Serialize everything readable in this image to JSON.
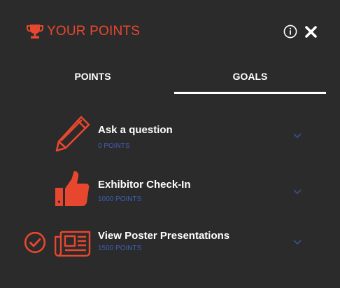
{
  "header": {
    "title": "YOUR POINTS",
    "icons": {
      "title_icon": "trophy-icon",
      "info": "info-icon",
      "close": "close-icon"
    }
  },
  "tabs": [
    {
      "label": "POINTS",
      "active": false
    },
    {
      "label": "GOALS",
      "active": true
    }
  ],
  "goals": [
    {
      "title": "Ask a question",
      "points": "0 POINTS",
      "icon": "pencil-icon",
      "completed": false
    },
    {
      "title": "Exhibitor Check-In",
      "points": "1000 POINTS",
      "icon": "thumbs-up-icon",
      "completed": false
    },
    {
      "title": "View Poster Presentations",
      "points": "1500 POINTS",
      "icon": "newspaper-icon",
      "completed": true
    }
  ],
  "colors": {
    "background": "#2b2b2b",
    "accent": "#e8472f",
    "points_text": "#3f5fb8",
    "chevron": "#3a4f86",
    "text": "#ffffff"
  }
}
